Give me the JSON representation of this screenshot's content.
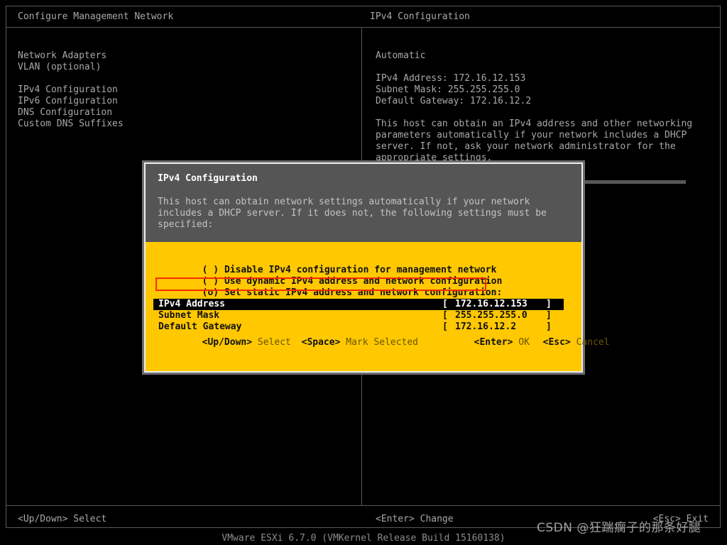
{
  "header": {
    "left_title": "Configure Management Network",
    "right_title": "IPv4 Configuration"
  },
  "left_menu": {
    "items": [
      {
        "label": "Network Adapters"
      },
      {
        "label": "VLAN (optional)"
      },
      {
        "label": "IPv4 Configuration"
      },
      {
        "label": "IPv6 Configuration"
      },
      {
        "label": "DNS Configuration"
      },
      {
        "label": "Custom DNS Suffixes"
      }
    ]
  },
  "right_pane": {
    "mode": "Automatic",
    "ipv4_address": "IPv4 Address: 172.16.12.153",
    "subnet_mask": "Subnet Mask: 255.255.255.0",
    "default_gateway": "Default Gateway: 172.16.12.2",
    "help_line1": "This host can obtain an IPv4 address and other networking",
    "help_line2": "parameters automatically if your network includes a DHCP",
    "help_line3": "server. If not, ask your network administrator for the",
    "help_line4": "appropriate settings."
  },
  "dialog": {
    "title": "IPv4 Configuration",
    "desc_line1": "This host can obtain network settings automatically if your network",
    "desc_line2": "includes a DHCP server. If it does not, the following settings must be",
    "desc_line3": "specified:",
    "options": [
      {
        "marker": "( )",
        "label": "Disable IPv4 configuration for management network",
        "selected": false
      },
      {
        "marker": "( )",
        "label": "Use dynamic IPv4 address and network configuration",
        "selected": false
      },
      {
        "marker": "(o)",
        "label": "Set static IPv4 address and network configuration:",
        "selected": true
      }
    ],
    "fields": [
      {
        "label": "IPv4 Address",
        "open_bracket": "[",
        "value": "172.16.12.153",
        "close_bracket": "]",
        "focused": true
      },
      {
        "label": "Subnet Mask",
        "open_bracket": "[",
        "value": "255.255.255.0",
        "close_bracket": "]",
        "focused": false
      },
      {
        "label": "Default Gateway",
        "open_bracket": "[",
        "value": "172.16.12.2",
        "close_bracket": "]",
        "focused": false
      }
    ],
    "keys": [
      {
        "name": "<Up/Down>",
        "desc": " Select"
      },
      {
        "name": "<Space>",
        "desc": " Mark Selected"
      },
      {
        "name": "<Enter>",
        "desc": " OK"
      },
      {
        "name": "<Esc>",
        "desc": " Cancel"
      }
    ]
  },
  "status_bar": {
    "left": "<Up/Down> Select",
    "center": "<Enter> Change",
    "right": "<Esc> Exit"
  },
  "version_line": "VMware ESXi 6.7.0 (VMKernel Release Build 15160138)",
  "watermark": "CSDN @狂踹瘸子的那条好腿",
  "colors": {
    "background": "#000000",
    "foreground": "#a8a8a8",
    "border": "#585858",
    "dialog_header_bg": "#555555",
    "dialog_body_bg": "#ffc800",
    "dialog_border": "#ededed",
    "dialog_shadow": "#6d6d6d",
    "selected_row_bg": "#000000",
    "selected_row_fg": "#ffffff",
    "annotation_red": "#fb2b06"
  }
}
